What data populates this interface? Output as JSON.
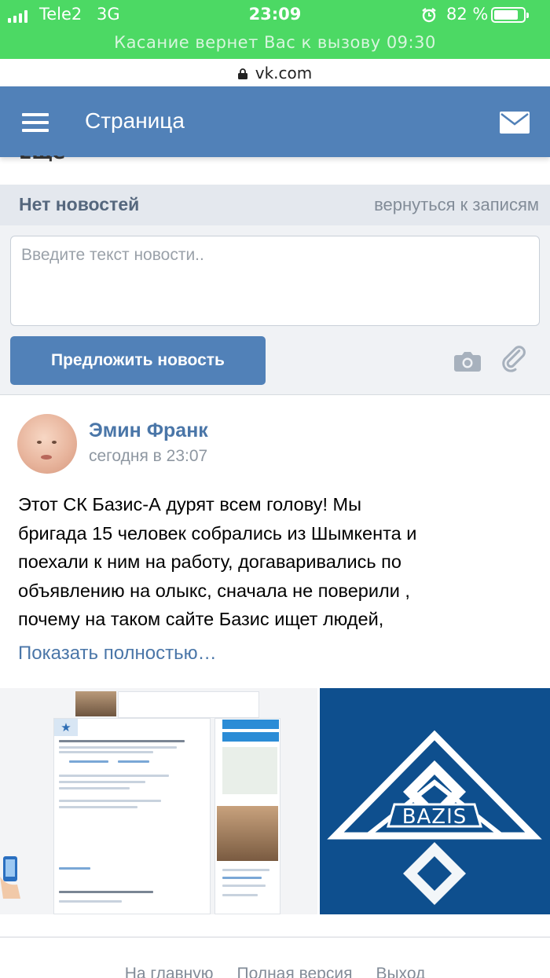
{
  "status_bar": {
    "carrier": "Tele2",
    "network": "3G",
    "time": "23:09",
    "battery_percent": "82 %",
    "battery_level": 0.82,
    "call_banner": "Касание вернет Вас к вызову 09:30",
    "bar_color": "#4cd964"
  },
  "browser": {
    "url": "vk.com"
  },
  "header": {
    "title": "Страница",
    "accent": "#5181b8"
  },
  "partial_heading": "Ещё",
  "news": {
    "title": "Нет новостей",
    "back_link": "вернуться к записям",
    "input_placeholder": "Введите текст новости..",
    "submit_label": "Предложить новость"
  },
  "post": {
    "author": "Эмин Франк",
    "date": "сегодня в 23:07",
    "text_lines": [
      "Этот СК Базис-А дурят всем голову! Мы",
      "бригада 15 человек собрались из Шымкента и",
      "поехали к ним на работу, догаваривались по",
      "объявлению на олыкс, сначала не поверили ,",
      "почему на таком сайте Базис ищет людей,"
    ],
    "show_more": "Показать полностью…",
    "images": {
      "logo_text": "BAZIS",
      "logo_bg": "#0e4f8e"
    }
  },
  "footer": {
    "links": [
      "На главную",
      "Полная версия",
      "Выход"
    ]
  }
}
